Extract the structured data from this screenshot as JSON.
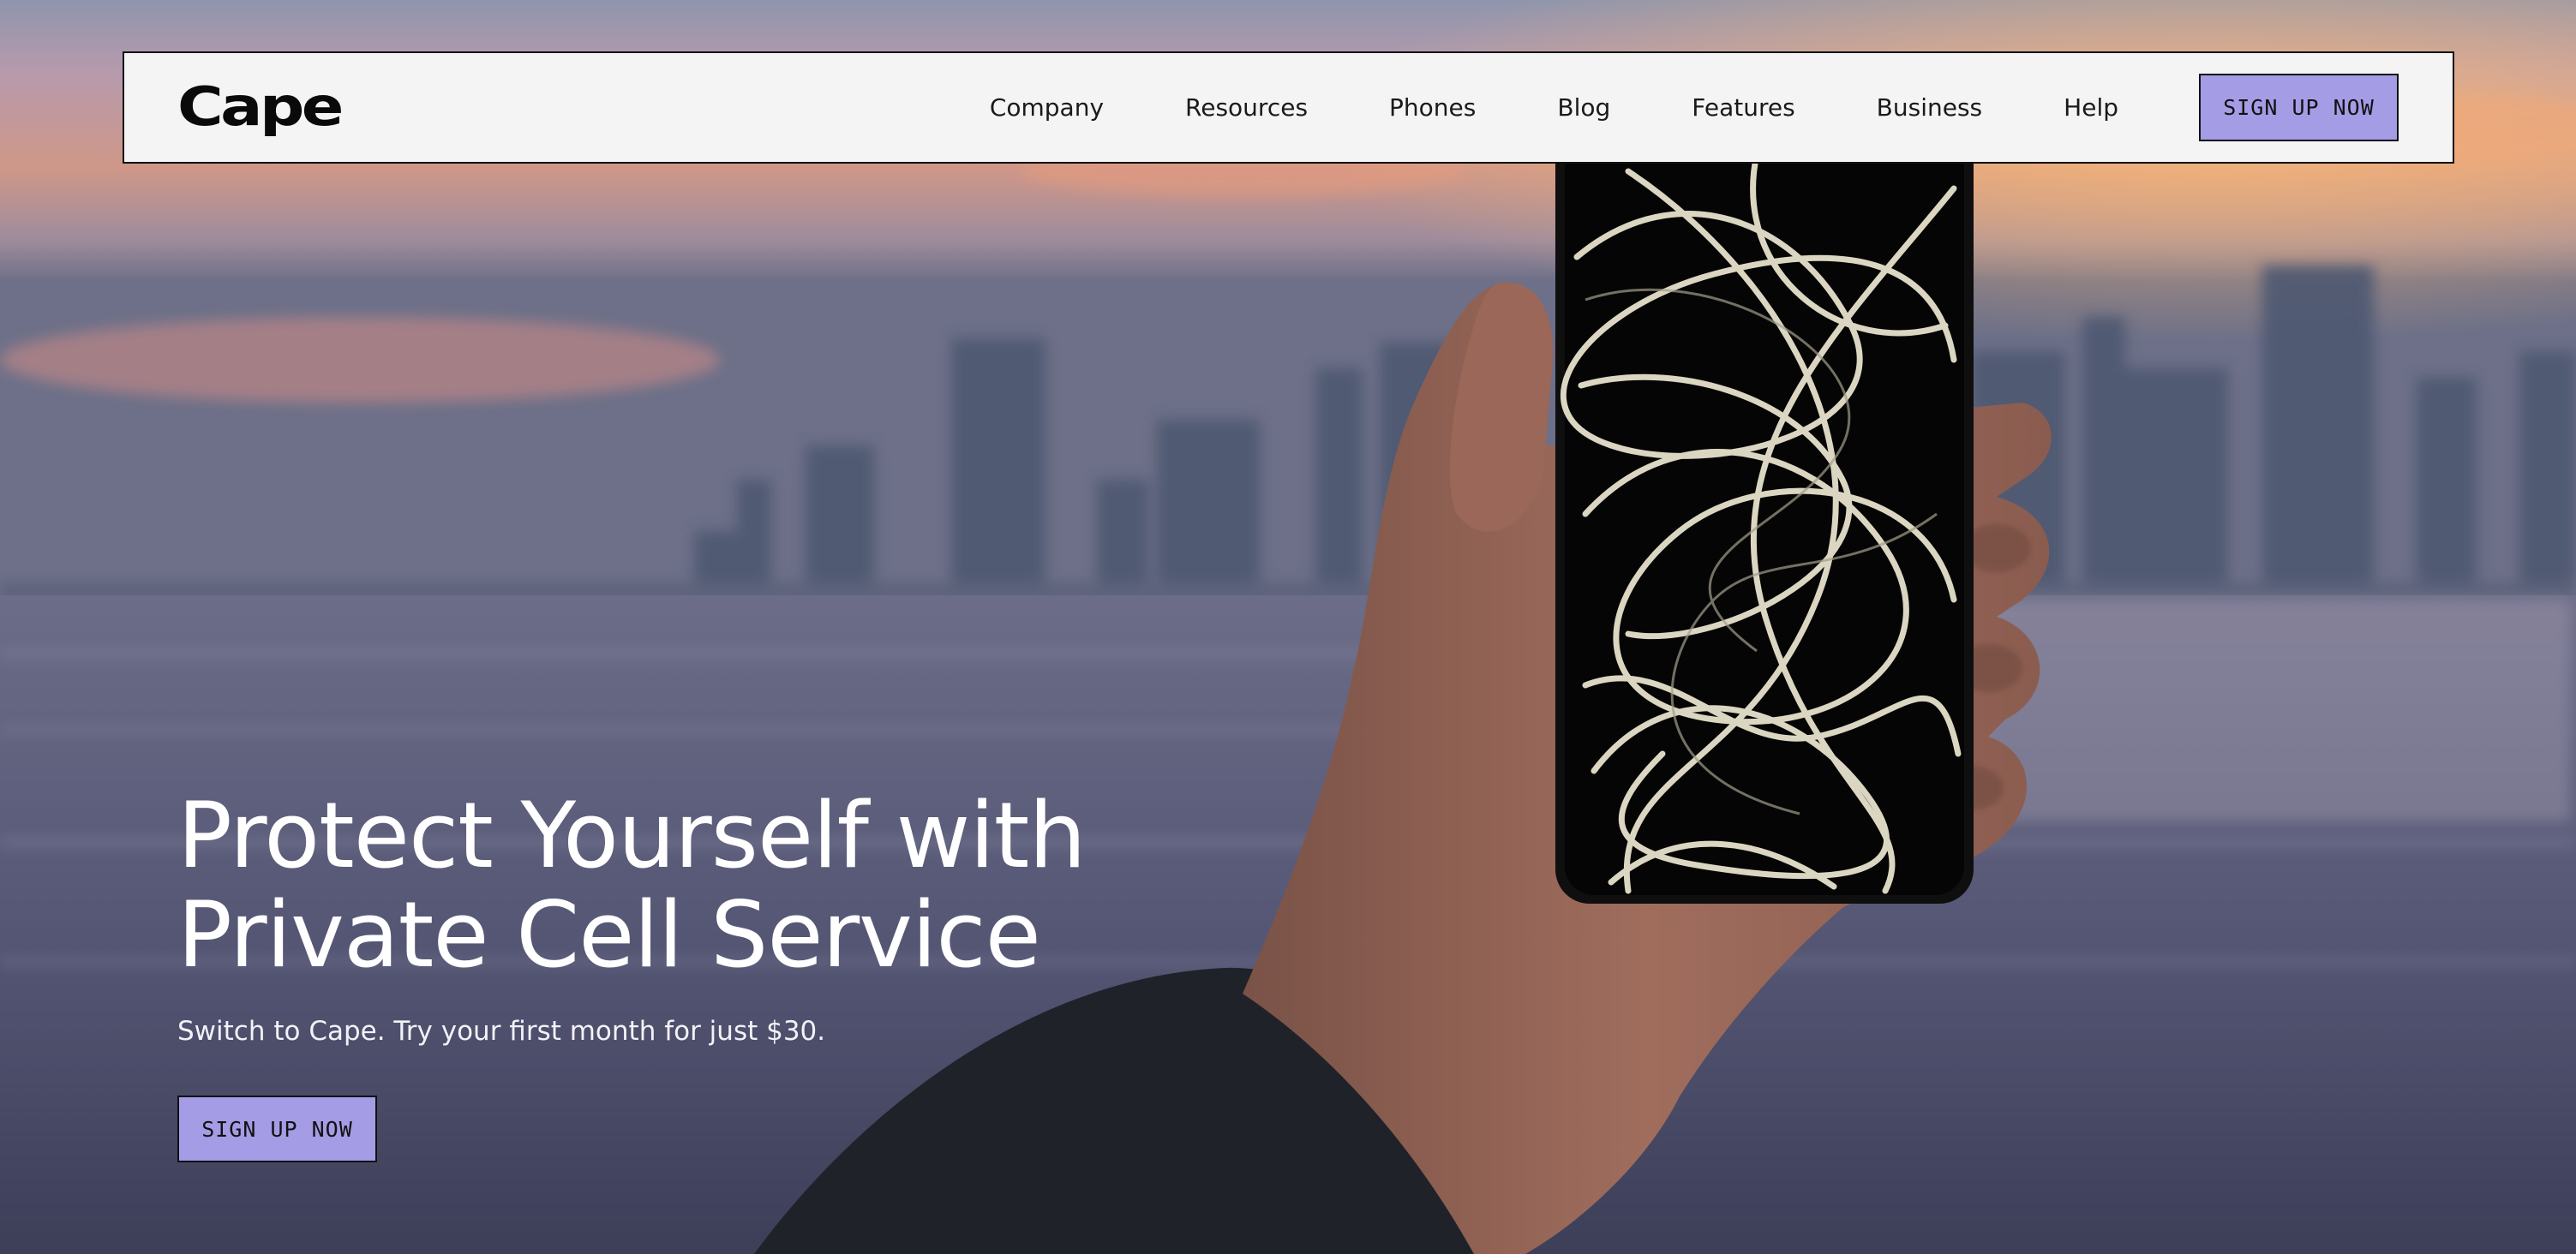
{
  "brand": {
    "logo_text": "Cape"
  },
  "nav": {
    "items": [
      {
        "label": "Company"
      },
      {
        "label": "Resources"
      },
      {
        "label": "Phones"
      },
      {
        "label": "Blog"
      },
      {
        "label": "Features"
      },
      {
        "label": "Business"
      },
      {
        "label": "Help"
      }
    ],
    "cta_label": "SIGN UP NOW"
  },
  "hero": {
    "headline_line1": "Protect Yourself with",
    "headline_line2": "Private Cell Service",
    "subhead": "Switch to Cape. Try your first month for just $30.",
    "cta_label": "SIGN UP NOW",
    "background_image": "blurred city skyline at sunset over water with a hand holding a phone"
  },
  "colors": {
    "accent": "#a59ce6",
    "nav_background": "#f4f4f4",
    "border": "#111111",
    "hero_text": "#ffffff"
  }
}
